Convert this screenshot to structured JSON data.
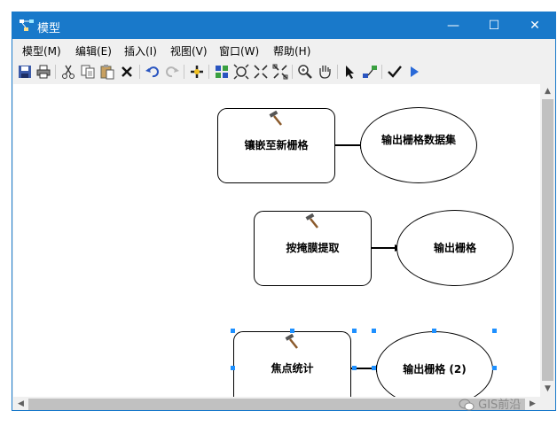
{
  "window": {
    "title": "模型",
    "minimize": "—",
    "maximize": "☐",
    "close": "✕"
  },
  "menu": [
    "模型(M)",
    "编辑(E)",
    "插入(I)",
    "视图(V)",
    "窗口(W)",
    "帮助(H)"
  ],
  "toolbar_icons": [
    "save-icon",
    "print-icon",
    "cut-icon",
    "copy-icon",
    "paste-icon",
    "delete-icon",
    "undo-icon",
    "redo-icon",
    "add-data-icon",
    "auto-layout-icon",
    "full-extent-icon",
    "zoom-in-fixed-icon",
    "zoom-out-fixed-icon",
    "zoom-in-icon",
    "pan-icon",
    "select-icon",
    "connect-icon",
    "validate-icon",
    "run-icon"
  ],
  "model": {
    "rows": [
      {
        "process": "镶嵌至新栅格",
        "output": "输出栅格数据集"
      },
      {
        "process": "按掩膜提取",
        "output": "输出栅格"
      },
      {
        "process": "焦点统计",
        "output": "输出栅格 (2)"
      }
    ]
  },
  "watermark": "GIS前沿"
}
